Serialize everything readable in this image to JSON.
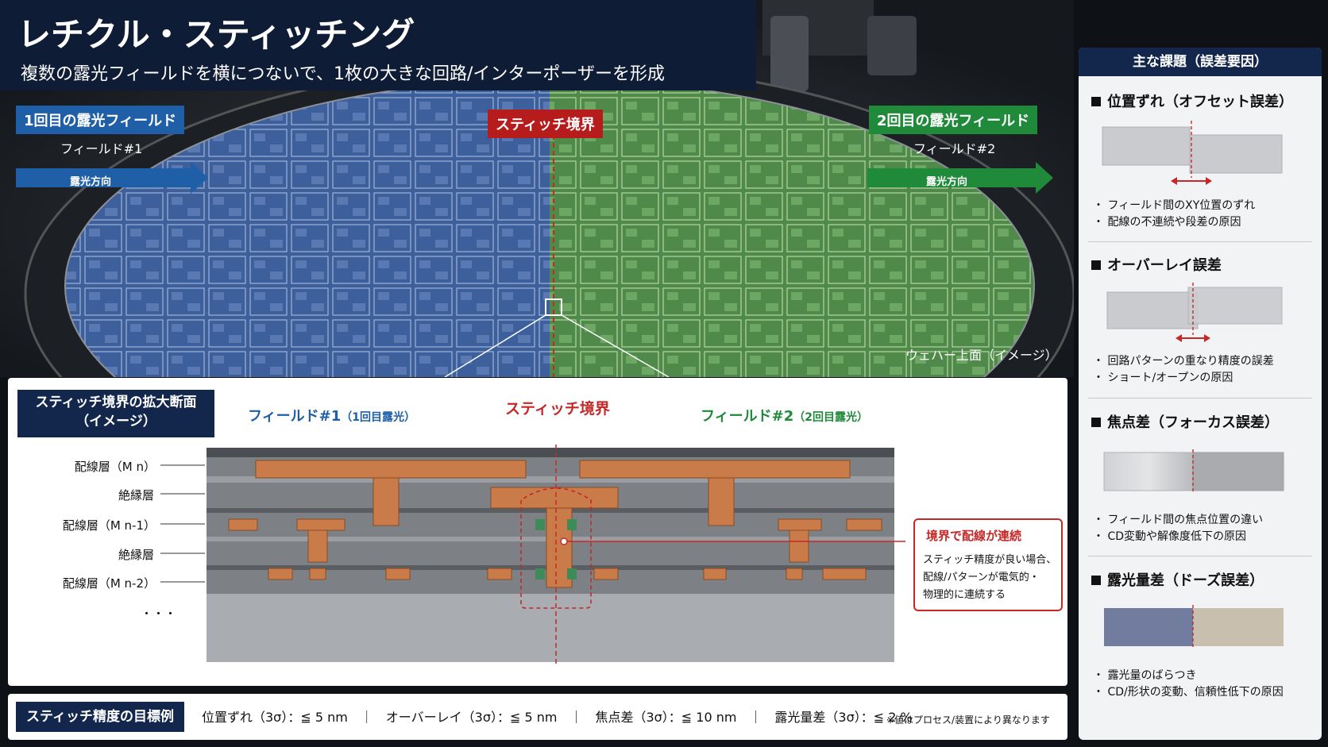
{
  "header": {
    "title": "レチクル・スティッチング",
    "subtitle": "複数の露光フィールドを横につないで、1枚の大きな回路/インターポーザーを形成"
  },
  "wafer": {
    "field1": {
      "tag": "1回目の露光フィールド",
      "sub": "フィールド#1",
      "arrow": "露光方向",
      "color": "#1f5fa8"
    },
    "field2": {
      "tag": "2回目の露光フィールド",
      "sub": "フィールド#2",
      "arrow": "露光方向",
      "color": "#1f8a3a"
    },
    "boundary_label": "スティッチ境界",
    "boundary_color": "#c62828",
    "caption": "ウェハー上面（イメージ）"
  },
  "cross_section": {
    "title_line1": "スティッチ境界の拡大断面",
    "title_line2": "（イメージ）",
    "field1_head": "フィールド#1",
    "field1_sub": "（1回目露光）",
    "boundary_head": "スティッチ境界",
    "field2_head": "フィールド#2",
    "field2_sub": "（2回目露光）",
    "layers": [
      "配線層（M n）",
      "絶縁層",
      "配線層（M n-1）",
      "絶縁層",
      "配線層（M n-2）"
    ],
    "ellipsis": "・・・",
    "callout": {
      "title": "境界で配線が連続",
      "lines": [
        "スティッチ精度が良い場合、",
        "配線/パターンが電気的・",
        "物理的に連続する"
      ]
    }
  },
  "targets": {
    "title": "スティッチ精度の目標例",
    "items": "位置ずれ（3σ）：≦ 5 nm　｜　オーバーレイ（3σ）：≦ 5 nm　｜　焦点差（3σ）：≦ 10 nm　｜　露光量差（3σ）：≦ 2 %",
    "note": "※値はプロセス/装置により異なります"
  },
  "side": {
    "title": "主な課題（誤差要因）",
    "issues": [
      {
        "title": "位置ずれ（オフセット誤差）",
        "bullets": [
          "・ フィールド間のXY位置のずれ",
          "・ 配線の不連続や段差の原因"
        ]
      },
      {
        "title": "オーバーレイ誤差",
        "bullets": [
          "・ 回路パターンの重なり精度の誤差",
          "・ ショート/オープンの原因"
        ]
      },
      {
        "title": "焦点差（フォーカス誤差）",
        "bullets": [
          "・ フィールド間の焦点位置の違い",
          "・ CD変動や解像度低下の原因"
        ]
      },
      {
        "title": "露光量差（ドーズ誤差）",
        "bullets": [
          "・ 露光量のばらつき",
          "・ CD/形状の変動、信頼性低下の原因"
        ]
      }
    ]
  }
}
